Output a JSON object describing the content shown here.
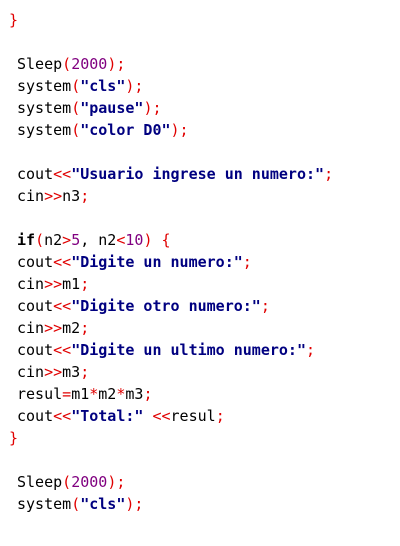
{
  "colors": {
    "default": "#000000",
    "punct": "#e00000",
    "string": "#000080",
    "number": "#800080",
    "background": "#ffffff"
  },
  "code_lines": [
    {
      "indent": 9,
      "tokens": [
        {
          "t": "}",
          "c": "p"
        }
      ]
    },
    {
      "indent": 17,
      "tokens": []
    },
    {
      "indent": 17,
      "tokens": [
        {
          "t": "Sleep"
        },
        {
          "t": "(",
          "c": "p"
        },
        {
          "t": "2000",
          "c": "n"
        },
        {
          "t": ");",
          "c": "p"
        }
      ]
    },
    {
      "indent": 17,
      "tokens": [
        {
          "t": "system"
        },
        {
          "t": "(",
          "c": "p"
        },
        {
          "t": "\"cls\"",
          "c": "s"
        },
        {
          "t": ");",
          "c": "p"
        }
      ]
    },
    {
      "indent": 17,
      "tokens": [
        {
          "t": "system"
        },
        {
          "t": "(",
          "c": "p"
        },
        {
          "t": "\"pause\"",
          "c": "s"
        },
        {
          "t": ");",
          "c": "p"
        }
      ]
    },
    {
      "indent": 17,
      "tokens": [
        {
          "t": "system"
        },
        {
          "t": "(",
          "c": "p"
        },
        {
          "t": "\"color D0\"",
          "c": "s"
        },
        {
          "t": ");",
          "c": "p"
        }
      ]
    },
    {
      "indent": 17,
      "tokens": []
    },
    {
      "indent": 17,
      "tokens": [
        {
          "t": "cout"
        },
        {
          "t": "<<",
          "c": "p"
        },
        {
          "t": "\"Usuario ingrese un numero:\"",
          "c": "s"
        },
        {
          "t": ";",
          "c": "p"
        }
      ]
    },
    {
      "indent": 17,
      "tokens": [
        {
          "t": "cin"
        },
        {
          "t": ">>",
          "c": "p"
        },
        {
          "t": "n3"
        },
        {
          "t": ";",
          "c": "p"
        }
      ]
    },
    {
      "indent": 17,
      "tokens": []
    },
    {
      "indent": 17,
      "tokens": [
        {
          "t": "if",
          "c": "k"
        },
        {
          "t": "(",
          "c": "p"
        },
        {
          "t": "n2"
        },
        {
          "t": ">",
          "c": "p"
        },
        {
          "t": "5",
          "c": "n"
        },
        {
          "t": ", n2"
        },
        {
          "t": "<",
          "c": "p"
        },
        {
          "t": "10",
          "c": "n"
        },
        {
          "t": ") {",
          "c": "p"
        }
      ]
    },
    {
      "indent": 17,
      "tokens": [
        {
          "t": "cout"
        },
        {
          "t": "<<",
          "c": "p"
        },
        {
          "t": "\"Digite un numero:\"",
          "c": "s"
        },
        {
          "t": ";",
          "c": "p"
        }
      ]
    },
    {
      "indent": 17,
      "tokens": [
        {
          "t": "cin"
        },
        {
          "t": ">>",
          "c": "p"
        },
        {
          "t": "m1"
        },
        {
          "t": ";",
          "c": "p"
        }
      ]
    },
    {
      "indent": 17,
      "tokens": [
        {
          "t": "cout"
        },
        {
          "t": "<<",
          "c": "p"
        },
        {
          "t": "\"Digite otro numero:\"",
          "c": "s"
        },
        {
          "t": ";",
          "c": "p"
        }
      ]
    },
    {
      "indent": 17,
      "tokens": [
        {
          "t": "cin"
        },
        {
          "t": ">>",
          "c": "p"
        },
        {
          "t": "m2"
        },
        {
          "t": ";",
          "c": "p"
        }
      ]
    },
    {
      "indent": 17,
      "tokens": [
        {
          "t": "cout"
        },
        {
          "t": "<<",
          "c": "p"
        },
        {
          "t": "\"Digite un ultimo numero:\"",
          "c": "s"
        },
        {
          "t": ";",
          "c": "p"
        }
      ]
    },
    {
      "indent": 17,
      "tokens": [
        {
          "t": "cin"
        },
        {
          "t": ">>",
          "c": "p"
        },
        {
          "t": "m3"
        },
        {
          "t": ";",
          "c": "p"
        }
      ]
    },
    {
      "indent": 17,
      "tokens": [
        {
          "t": "resul"
        },
        {
          "t": "=",
          "c": "p"
        },
        {
          "t": "m1"
        },
        {
          "t": "*",
          "c": "p"
        },
        {
          "t": "m2"
        },
        {
          "t": "*",
          "c": "p"
        },
        {
          "t": "m3"
        },
        {
          "t": ";",
          "c": "p"
        }
      ]
    },
    {
      "indent": 17,
      "tokens": [
        {
          "t": "cout"
        },
        {
          "t": "<<",
          "c": "p"
        },
        {
          "t": "\"Total:\"",
          "c": "s"
        },
        {
          "t": " "
        },
        {
          "t": "<<",
          "c": "p"
        },
        {
          "t": "resul"
        },
        {
          "t": ";",
          "c": "p"
        }
      ]
    },
    {
      "indent": 9,
      "tokens": [
        {
          "t": "}",
          "c": "p"
        }
      ]
    },
    {
      "indent": 17,
      "tokens": []
    },
    {
      "indent": 17,
      "tokens": [
        {
          "t": "Sleep"
        },
        {
          "t": "(",
          "c": "p"
        },
        {
          "t": "2000",
          "c": "n"
        },
        {
          "t": ");",
          "c": "p"
        }
      ]
    },
    {
      "indent": 17,
      "tokens": [
        {
          "t": "system"
        },
        {
          "t": "(",
          "c": "p"
        },
        {
          "t": "\"cls\"",
          "c": "s"
        },
        {
          "t": ");",
          "c": "p"
        }
      ]
    }
  ]
}
